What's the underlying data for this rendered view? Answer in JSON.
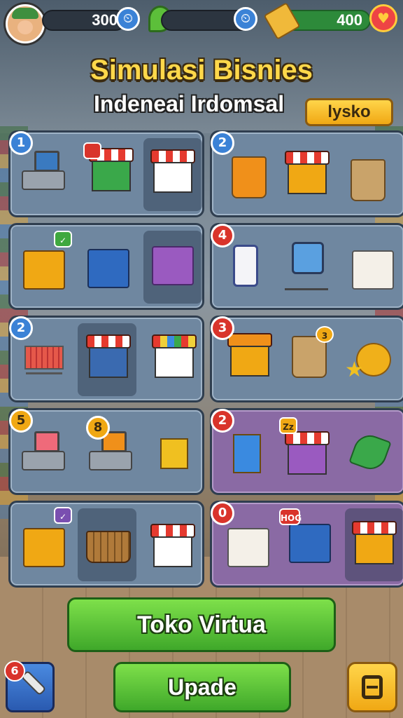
{
  "hud": {
    "coins": "300",
    "cash": "400",
    "clock_icon": "clock-icon",
    "leaf_icon": "leaf-icon",
    "cash_icon": "cash-icon",
    "heart_icon": "heart-icon"
  },
  "title": "Simulasi Bisnies",
  "subtitle": "Indeneai Irdomsal",
  "header_button": "lysko",
  "cards": [
    {
      "badge": "1"
    },
    {
      "badge": "2"
    },
    {
      "badge": ""
    },
    {
      "badge": "4"
    },
    {
      "badge": "2"
    },
    {
      "badge": "3"
    },
    {
      "badge": "5",
      "badge2": "8"
    },
    {
      "badge": "2"
    },
    {
      "badge": ""
    },
    {
      "badge": "0"
    }
  ],
  "item_badges": {
    "c1_mini": "",
    "c6_mini": "3",
    "c8_mini": "Zz",
    "c10_mini": "HOG"
  },
  "buttons": {
    "toko": "Toko Virtua",
    "upade": "Upade",
    "tool_badge": "6"
  },
  "colors": {
    "title": "#ffd84a",
    "green_button": "#3fa82a",
    "panel_blue": "#6f87a0",
    "panel_purple": "#8a6aa4"
  }
}
